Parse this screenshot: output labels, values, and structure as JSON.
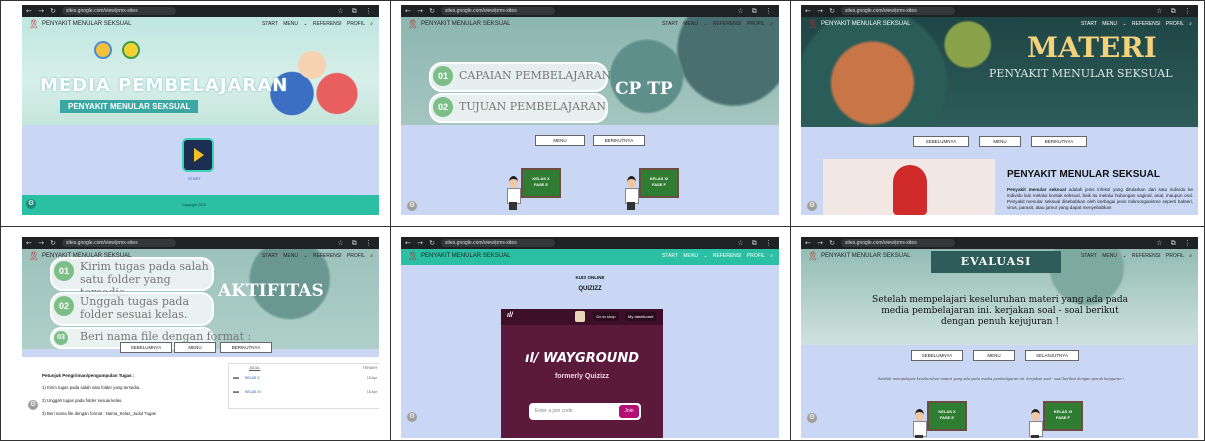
{
  "browser": {
    "url": "sites.google.com/view/pms-sites"
  },
  "panels": [
    {
      "site_title": "PENYAKIT MENULAR SEKSUAL",
      "nav": [
        "START",
        "MENU ⌄",
        "REFERENSI",
        "PROFIL"
      ],
      "hero_line1": "MEDIA PEMBELAJARAN",
      "hero_line2": "PENYAKIT MENULAR SEKSUAL",
      "play_label": "START",
      "footer": "Copyright 2025"
    },
    {
      "site_title": "PENYAKIT MENULAR SEKSUAL",
      "nav": [
        "START",
        "MENU ⌄",
        "REFERENSI",
        "PROFIL"
      ],
      "items": [
        {
          "num": "01",
          "label": "CAPAIAN PEMBELAJARAN"
        },
        {
          "num": "02",
          "label": "TUJUAN PEMBELAJARAN"
        }
      ],
      "big_label": "CP TP",
      "buttons": [
        "MENU",
        "BERIKUTNYA"
      ],
      "class_cards": [
        {
          "line1": "KELAS X",
          "line2": "FASE E"
        },
        {
          "line1": "KELAS XI",
          "line2": "FASE F"
        }
      ]
    },
    {
      "site_title": "PENYAKIT MENULAR SEKSUAL",
      "nav": [
        "START",
        "MENU ⌄",
        "REFERENSI",
        "PROFIL"
      ],
      "hero_title": "MATERI",
      "hero_subtitle": "PENYAKIT MENULAR SEKSUAL",
      "buttons": [
        "SEBELUMNYA",
        "MENU",
        "BERIKUTNYA"
      ],
      "section_title": "PENYAKIT MENULAR SEKSUAL",
      "body_bold": "Penyakit menular seksual",
      "body_text": " adalah jenis infeksi yang ditularkan dari satu individu ke individu lain melalui kontak seksual, baik itu melalui hubungan vaginal, anal, maupun oral. Penyakit menular seksual disebabkan oleh berbagai jenis mikroorganisme seperti bakteri, virus, parasit, atau jamur yang dapat menyebabkan"
    },
    {
      "site_title": "PENYAKIT MENULAR SEKSUAL",
      "nav": [
        "START",
        "MENU ⌄",
        "REFERENSI",
        "PROFIL"
      ],
      "items": [
        {
          "num": "01",
          "label": "Kirim tugas pada salah satu folder yang tersedia."
        },
        {
          "num": "02",
          "label": "Unggah tugas pada folder sesuai kelas."
        },
        {
          "num": "03",
          "label": "Beri nama file dengan format :"
        }
      ],
      "big_label": "AKTIFITAS",
      "buttons": [
        "SEBELUMNYA",
        "MENU",
        "BERIKUTNYA"
      ],
      "guide_title": "Petunjuk Pengiriman/pengumpulan Tugas :",
      "guide_steps": [
        "1) Kirim tugas pada salah satu folder yang tersedia.",
        "2) Unggah tugas pada folder sesuai kelas.",
        "3) Beri nama file dengan format : Nama_Kelas_Judul Tugas"
      ],
      "folder_header": "JUDUL",
      "folder_header_right": "TERAKH",
      "folders": [
        {
          "name": "KELAS X",
          "date": "15 Apr"
        },
        {
          "name": "KELAS XI",
          "date": "15 Apr"
        }
      ]
    },
    {
      "site_title": "PENYAKIT MENULAR SEKSUAL",
      "nav": [
        "START",
        "MENU ⌄",
        "REFERENSI",
        "PROFIL"
      ],
      "kuis_label": "KUIS ONLINE",
      "kuis_title": "QUIZIZZ",
      "shop_button": "Go to shop",
      "dashboard_button": "My dashboard",
      "brand": "WAYGROUND",
      "brand_sub": "formerly Quizizz",
      "join_placeholder": "Enter a join code",
      "join_button": "Join"
    },
    {
      "site_title": "PENYAKIT MENULAR SEKSUAL",
      "nav": [
        "START",
        "MENU ⌄",
        "REFERENSI",
        "PROFIL"
      ],
      "hero_title": "EVALUASI",
      "message": "Setelah mempelajari keseluruhan materi yang ada pada media pembelajaran ini. kerjakan soal - soal berikut dengan penuh kejujuran !",
      "buttons": [
        "SEBELUMNYA",
        "MENU",
        "SELANJUTNYA"
      ],
      "small_note": "Setelah mempelajari keseluruhan materi yang ada pada media pembelajaran ini. kerjakan soal - soal berikut dengan penuh kejujuran !",
      "class_cards": [
        {
          "line1": "KELAS X",
          "line2": "FASE E"
        },
        {
          "line1": "KELAS XI",
          "line2": "FASE F"
        }
      ]
    }
  ],
  "colors": {
    "sky": "#c9d7f5",
    "teal": "#2bbfa4",
    "green": "#7bbf86",
    "dark_teal": "#214a4a",
    "wine": "#5b1a3c"
  }
}
